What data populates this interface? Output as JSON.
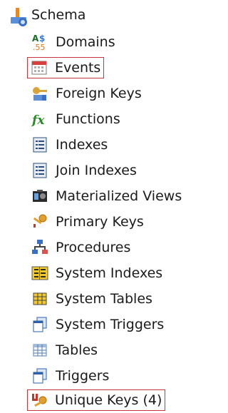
{
  "tree": {
    "root": {
      "label": "Schema",
      "icon": "schema-folder-icon"
    },
    "items": [
      {
        "label": "Domains",
        "icon": "domains-icon"
      },
      {
        "label": "Events",
        "icon": "events-icon"
      },
      {
        "label": "Foreign Keys",
        "icon": "foreign-keys-icon"
      },
      {
        "label": "Functions",
        "icon": "functions-icon"
      },
      {
        "label": "Indexes",
        "icon": "indexes-icon"
      },
      {
        "label": "Join Indexes",
        "icon": "join-indexes-icon"
      },
      {
        "label": "Materialized Views",
        "icon": "materialized-views-icon"
      },
      {
        "label": "Primary Keys",
        "icon": "primary-keys-icon"
      },
      {
        "label": "Procedures",
        "icon": "procedures-icon"
      },
      {
        "label": "System Indexes",
        "icon": "system-indexes-icon"
      },
      {
        "label": "System Tables",
        "icon": "system-tables-icon"
      },
      {
        "label": "System Triggers",
        "icon": "system-triggers-icon"
      },
      {
        "label": "Tables",
        "icon": "tables-icon"
      },
      {
        "label": "Triggers",
        "icon": "triggers-icon"
      },
      {
        "label": "Unique Keys (4)",
        "icon": "unique-keys-icon"
      }
    ],
    "highlight_color": "#c8363c"
  }
}
